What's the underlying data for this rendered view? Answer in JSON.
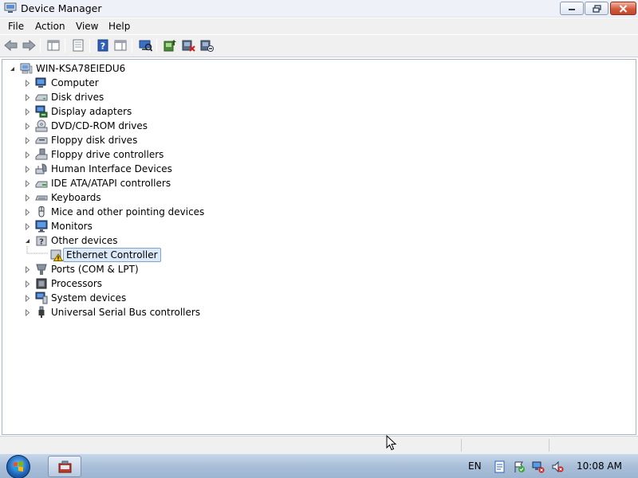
{
  "window": {
    "title": "Device Manager"
  },
  "menu": {
    "items": [
      {
        "label": "File"
      },
      {
        "label": "Action"
      },
      {
        "label": "View"
      },
      {
        "label": "Help"
      }
    ]
  },
  "toolbar": {
    "buttons": [
      {
        "icon": "back-arrow-icon"
      },
      {
        "icon": "forward-arrow-icon"
      },
      {
        "icon": "show-hide-console-tree-icon"
      },
      {
        "icon": "properties-icon"
      },
      {
        "icon": "help-icon"
      },
      {
        "icon": "action-pane-icon"
      },
      {
        "icon": "scan-hardware-changes-icon"
      },
      {
        "icon": "update-driver-icon"
      },
      {
        "icon": "disable-device-icon"
      },
      {
        "icon": "uninstall-device-icon"
      }
    ]
  },
  "tree": {
    "root": "WIN-KSA78EIEDU6",
    "categories": [
      {
        "label": "Computer",
        "icon": "computer-icon"
      },
      {
        "label": "Disk drives",
        "icon": "disk-drive-icon"
      },
      {
        "label": "Display adapters",
        "icon": "display-adapter-icon"
      },
      {
        "label": "DVD/CD-ROM drives",
        "icon": "dvd-drive-icon"
      },
      {
        "label": "Floppy disk drives",
        "icon": "floppy-drive-icon"
      },
      {
        "label": "Floppy drive controllers",
        "icon": "floppy-controller-icon"
      },
      {
        "label": "Human Interface Devices",
        "icon": "hid-icon"
      },
      {
        "label": "IDE ATA/ATAPI controllers",
        "icon": "ide-controller-icon"
      },
      {
        "label": "Keyboards",
        "icon": "keyboard-icon"
      },
      {
        "label": "Mice and other pointing devices",
        "icon": "mouse-icon"
      },
      {
        "label": "Monitors",
        "icon": "monitor-icon"
      },
      {
        "label": "Other devices",
        "icon": "other-devices-icon",
        "expanded": true
      },
      {
        "label": "Ports (COM & LPT)",
        "icon": "port-icon"
      },
      {
        "label": "Processors",
        "icon": "processor-icon"
      },
      {
        "label": "System devices",
        "icon": "system-devices-icon"
      },
      {
        "label": "Universal Serial Bus controllers",
        "icon": "usb-icon"
      }
    ],
    "child": {
      "label": "Ethernet Controller",
      "icon": "warning-device-icon",
      "selected": true
    }
  },
  "taskbar": {
    "language": "EN",
    "clock": "10:08 AM"
  },
  "colors": {
    "selection_bg": "#dce9f8",
    "selection_border": "#7da2ce",
    "close_button": "#c3462b",
    "warning": "#f2c200"
  }
}
